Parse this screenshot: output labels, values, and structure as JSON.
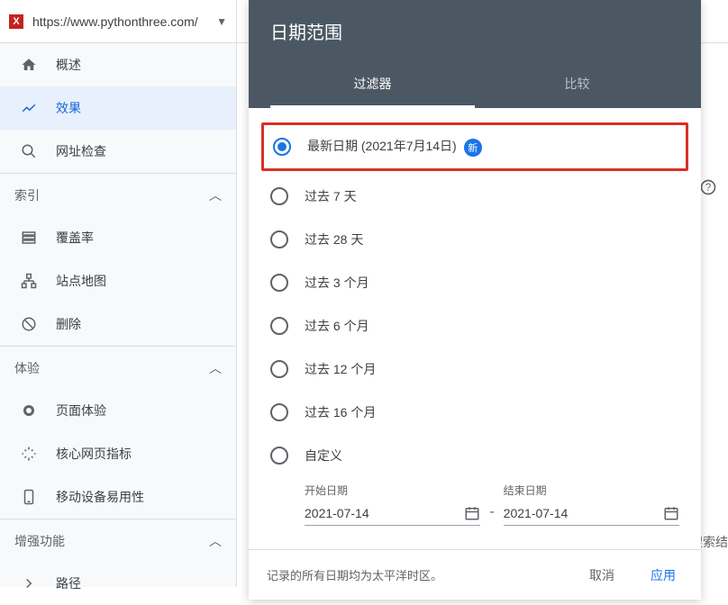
{
  "url_bar": {
    "url": "https://www.pythonthree.com/",
    "favicon": "X"
  },
  "nav": {
    "overview": "概述",
    "performance": "效果",
    "url_inspect": "网址检查"
  },
  "sections": {
    "index": {
      "title": "索引",
      "items": {
        "coverage": "覆盖率",
        "sitemap": "站点地图",
        "removal": "删除"
      }
    },
    "experience": {
      "title": "体验",
      "items": {
        "page_exp": "页面体验",
        "core_vitals": "核心网页指标",
        "mobile": "移动设备易用性"
      }
    },
    "enhance": {
      "title": "增强功能",
      "items": {
        "path": "路径"
      }
    }
  },
  "right": {
    "search": "搜索结"
  },
  "modal": {
    "title": "日期范围",
    "tabs": {
      "filter": "过滤器",
      "compare": "比较"
    },
    "options": {
      "latest": "最新日期 (2021年7月14日)",
      "badge": "新",
      "d7": "过去 7 天",
      "d28": "过去 28 天",
      "m3": "过去 3 个月",
      "m6": "过去 6 个月",
      "m12": "过去 12 个月",
      "m16": "过去 16 个月",
      "custom": "自定义"
    },
    "date": {
      "start_label": "开始日期",
      "end_label": "结束日期",
      "start": "2021-07-14",
      "end": "2021-07-14",
      "sep": "-"
    },
    "footer": {
      "note": "记录的所有日期均为太平洋时区。",
      "cancel": "取消",
      "apply": "应用"
    }
  }
}
